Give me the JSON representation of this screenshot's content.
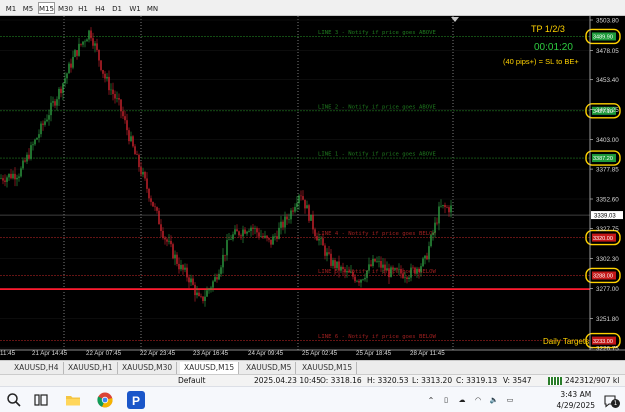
{
  "timeframes": [
    "M1",
    "M5",
    "M15",
    "M30",
    "H1",
    "H4",
    "D1",
    "W1",
    "MN"
  ],
  "active_timeframe": "M15",
  "chart": {
    "symbol": "XAUUSD",
    "price_axis": [
      "3503.80",
      "3478.05",
      "3453.40",
      "3428.25",
      "3403.00",
      "3377.85",
      "3352.60",
      "3327.75",
      "3302.30",
      "3277.00",
      "3251.80",
      "3226.75"
    ],
    "price_range": [
      3226.75,
      3503.8
    ],
    "time_labels": [
      "11:45",
      "21 Apr 14:45",
      "22 Apr 07:45",
      "22 Apr 23:45",
      "23 Apr 16:45",
      "24 Apr 09:45",
      "25 Apr 02:45",
      "25 Apr 18:45",
      "28 Apr 11:45"
    ],
    "current_price_label": "3339.03",
    "overlay": {
      "title": "TP 1/2/3",
      "timer": "00:01:20",
      "note": "(40 pips+) = SL to BE+",
      "daily_targets": "Daily Targets"
    },
    "levels": [
      {
        "label": "LINE 3 - Notify if price goes ABOVE",
        "price": 3489.9,
        "color": "#1f7a1f",
        "box": "3489.90",
        "box_color": "#1e9a3a"
      },
      {
        "label": "LINE 2 - Notify if price goes ABOVE",
        "price": 3427.1,
        "color": "#1f7a1f",
        "box": "3427.10",
        "box_color": "#1e9a3a"
      },
      {
        "label": "LINE 1 - Notify if price goes ABOVE",
        "price": 3387.2,
        "color": "#1f7a1f",
        "box": "3387.20",
        "box_color": "#1e9a3a"
      },
      {
        "label": "LINE 4 - Notify if price goes BELOW",
        "price": 3320.0,
        "color": "#a02020",
        "box": "3320.00",
        "box_color": "#c41818"
      },
      {
        "label": "LINE 5 - Notify if price goes BELOW",
        "price": 3288.0,
        "color": "#a02020",
        "box": "3288.00",
        "box_color": "#c41818"
      },
      {
        "label": "LINE 6 - Notify if price goes BELOW",
        "price": 3233.0,
        "color": "#a02020",
        "box": "3233.00",
        "box_color": "#c41818"
      }
    ],
    "red_line_price": 3276.5
  },
  "tabs": [
    "XAUUSD,H4",
    "XAUUSD,H1",
    "XAUUSD,M30",
    "XAUUSD,M15",
    "XAUUSD,M5",
    "XAUUSD,M15"
  ],
  "status": {
    "profile": "Default",
    "datetime": "2025.04.23 10:45",
    "open": "O: 3318.16",
    "high": "H: 3320.53",
    "low": "L: 3313.20",
    "close": "C: 3319.13",
    "volume": "V: 3547",
    "traffic": "242312/907 kl"
  },
  "taskbar": {
    "time": "3:43 AM",
    "date": "4/29/2025",
    "notification_count": "1"
  }
}
